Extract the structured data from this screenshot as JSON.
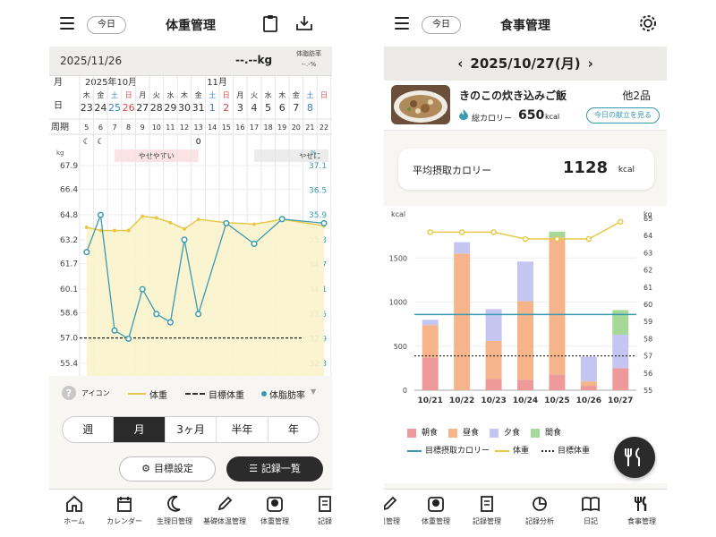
{
  "left": {
    "header": {
      "title": "体重管理",
      "today": "今日"
    },
    "date": "2025/11/26",
    "weight_display": "--.--kg",
    "fat_label_1": "体脂肪率",
    "fat_display": "--.-%",
    "months": {
      "oct": "2025年10月",
      "nov": "11月"
    },
    "row_labels": {
      "month": "月",
      "day": "日",
      "period": "周期"
    },
    "weekdays": [
      "木",
      "金",
      "土",
      "日",
      "月",
      "火",
      "水",
      "木",
      "金",
      "土",
      "日",
      "月",
      "火",
      "水",
      "木",
      "金",
      "土",
      "日"
    ],
    "days": [
      "23",
      "24",
      "25",
      "26",
      "27",
      "28",
      "29",
      "30",
      "31",
      "1",
      "2",
      "3",
      "4",
      "5",
      "6",
      "7",
      "8"
    ],
    "period_nums": [
      "5",
      "6",
      "7",
      "8",
      "9",
      "10",
      "11",
      "12",
      "13",
      "14",
      "15",
      "16",
      "17",
      "18",
      "19",
      "20",
      "21",
      "22"
    ],
    "y_unit_left": "kg",
    "y_unit_right": "%",
    "y_left": [
      "67.9",
      "66.4",
      "64.8",
      "63.2",
      "61.7",
      "60.1",
      "58.6",
      "57.0",
      "55.4"
    ],
    "y_right": [
      "37.1",
      "36.5",
      "35.9",
      "35.3",
      "34.7",
      "34.1",
      "33.5",
      "32.9",
      "32.3"
    ],
    "band_label_1": "やせやすい",
    "band_label_2": "やせに",
    "legend": {
      "icon": "アイコン",
      "weight": "体重",
      "target": "目標体重",
      "fat": "体脂肪率"
    },
    "periods": [
      "週",
      "月",
      "3ヶ月",
      "半年",
      "年"
    ],
    "selected_period": "月",
    "buttons": {
      "goal": "目標設定",
      "records": "記録一覧"
    },
    "nav": [
      "ホーム",
      "カレンダー",
      "生理日管理",
      "基礎体温管理",
      "体重管理",
      "記録"
    ]
  },
  "right": {
    "header": {
      "title": "食事管理",
      "today": "今日"
    },
    "date": "2025/10/27(月)",
    "meal_name": "きのこの炊き込みご飯",
    "meal_more": "他2品",
    "calorie_label": "総カロリー",
    "calorie_value": "650",
    "calorie_unit": "kcal",
    "today_menu_button": "今日の献立を見る",
    "avg_label": "平均摂取カロリー",
    "avg_value": "1128",
    "avg_unit": "kcal",
    "nav": [
      "温管理",
      "体重管理",
      "記録管理",
      "記録分析",
      "日記",
      "食事管理"
    ]
  },
  "colors": {
    "accent": "#3a9ab0",
    "weight_line": "#e6c84a",
    "breakfast": "#ef9a9a",
    "lunch": "#f6b48a",
    "dinner": "#c5c5f2",
    "snack": "#a6d89a",
    "dark": "#2b2b2b"
  },
  "chart_data": [
    {
      "type": "line",
      "ylabel": "kg",
      "ylim": [
        54.6,
        68.7
      ],
      "ylim_right": [
        32.0,
        37.4
      ],
      "x": [
        "5",
        "6",
        "7",
        "8",
        "9",
        "10",
        "11",
        "12",
        "13",
        "14",
        "15",
        "16",
        "17",
        "18",
        "19",
        "20",
        "21",
        "22"
      ],
      "series": [
        {
          "name": "体重",
          "axis": "left",
          "values": [
            64.0,
            63.8,
            63.8,
            63.8,
            64.7,
            64.6,
            64.3,
            63.9,
            64.5,
            null,
            64.3,
            null,
            64.2,
            null,
            64.5,
            null,
            null,
            64.1
          ]
        },
        {
          "name": "体脂肪率",
          "axis": "right",
          "values": [
            35.0,
            35.9,
            33.1,
            32.9,
            34.1,
            33.5,
            33.3,
            35.3,
            33.5,
            null,
            35.7,
            null,
            35.2,
            null,
            35.8,
            null,
            null,
            35.7
          ]
        }
      ],
      "target": 57.0,
      "grid": true,
      "legend": "bottom"
    },
    {
      "type": "bar",
      "categories": [
        "10/21",
        "10/22",
        "10/23",
        "10/24",
        "10/25",
        "10/26",
        "10/27"
      ],
      "ylabel": "kcal",
      "ylim": [
        0,
        1950
      ],
      "y_ticks": [
        0,
        500,
        1000,
        1500
      ],
      "ylim_right": [
        55,
        65
      ],
      "y_ticks_right": [
        55,
        56,
        57,
        58,
        59,
        60,
        61,
        62,
        63,
        64,
        65
      ],
      "series": [
        {
          "name": "朝食",
          "values": [
            370,
            0,
            130,
            120,
            180,
            50,
            250
          ]
        },
        {
          "name": "昼食",
          "values": [
            370,
            1550,
            430,
            890,
            1550,
            50,
            0
          ]
        },
        {
          "name": "夕食",
          "values": [
            60,
            130,
            360,
            450,
            0,
            280,
            380
          ]
        },
        {
          "name": "間食",
          "values": [
            0,
            0,
            0,
            0,
            70,
            0,
            280
          ]
        }
      ],
      "line_series": [
        {
          "name": "体重",
          "axis": "right",
          "values": [
            64.2,
            64.2,
            64.2,
            63.8,
            63.8,
            63.8,
            64.8
          ]
        }
      ],
      "target_calorie": 860,
      "target_weight": 57.0,
      "legend": "bottom"
    }
  ]
}
